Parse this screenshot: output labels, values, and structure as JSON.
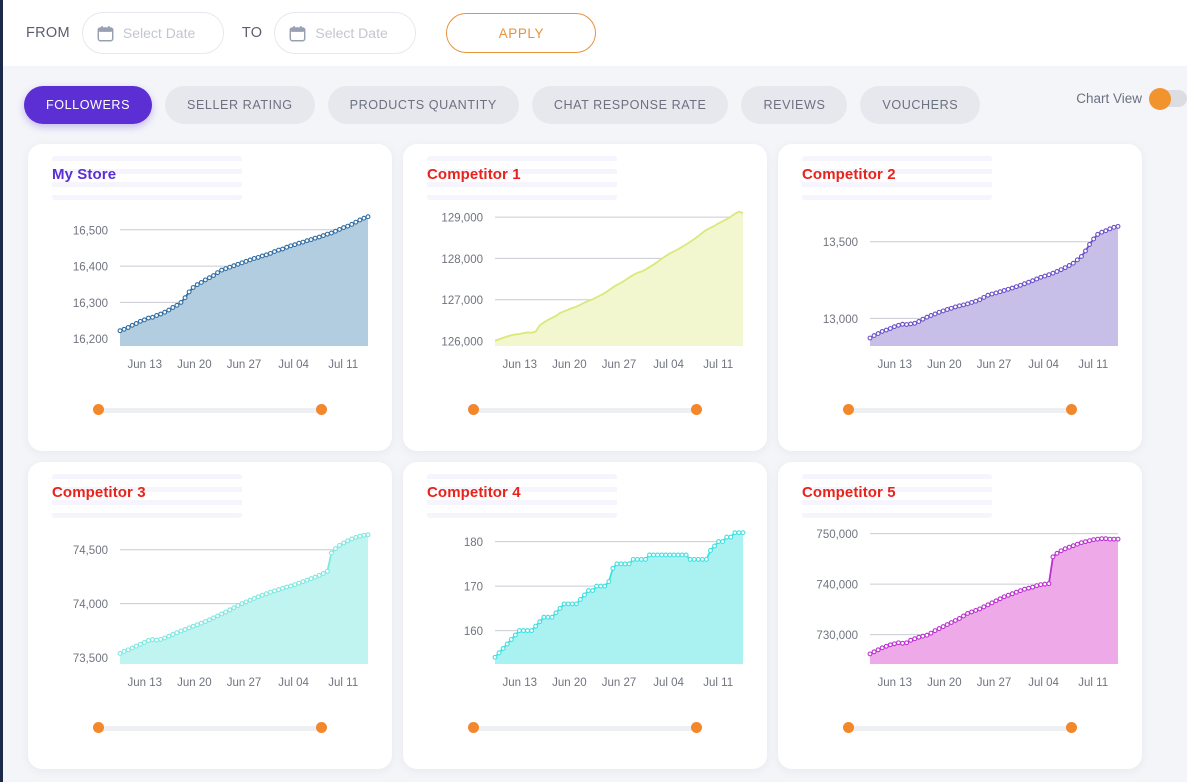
{
  "toolbar": {
    "from_label": "FROM",
    "to_label": "TO",
    "from_placeholder": "Select Date",
    "to_placeholder": "Select Date",
    "from_value": "",
    "to_value": "",
    "apply_label": "APPLY",
    "calendar_icon": "calendar-icon",
    "apply_color": "#e8923a"
  },
  "tabs": [
    {
      "label": "FOLLOWERS",
      "active": true
    },
    {
      "label": "SELLER RATING",
      "active": false
    },
    {
      "label": "PRODUCTS QUANTITY",
      "active": false
    },
    {
      "label": "CHAT RESPONSE RATE",
      "active": false
    },
    {
      "label": "REVIEWS",
      "active": false
    },
    {
      "label": "VOUCHERS",
      "active": false
    }
  ],
  "chart_view_toggle": {
    "label": "Chart View",
    "state": "on",
    "knob_color": "#f2942e",
    "track_color": "#dcdde3"
  },
  "colors": {
    "active_tab": "#5b2fd4",
    "competitor_title": "#e8231b",
    "mystore_title": "#5b2fd4",
    "slider_handle": "#f2872b",
    "page_background": "#f4f5f9"
  },
  "chart_data": [
    {
      "type": "area",
      "title": "My Store",
      "title_color": "#5b2fd4",
      "line_color": "#2e6da4",
      "fill_color": "#b3cde0",
      "marker": true,
      "xlabel": "",
      "ylabel": "",
      "ytick_labels": [
        "16,200",
        "16,300",
        "16,400",
        "16,500"
      ],
      "ylim": [
        16180,
        16560
      ],
      "xtick_labels": [
        "Jun 13",
        "Jun 20",
        "Jun 27",
        "Jul 04",
        "Jul 11"
      ],
      "grid": true,
      "legend": "none",
      "values": [
        16222,
        16226,
        16231,
        16237,
        16242,
        16248,
        16252,
        16257,
        16259,
        16264,
        16268,
        16273,
        16279,
        16286,
        16292,
        16300,
        16313,
        16329,
        16341,
        16349,
        16355,
        16362,
        16368,
        16374,
        16382,
        16389,
        16393,
        16397,
        16401,
        16405,
        16409,
        16413,
        16417,
        16421,
        16424,
        16428,
        16431,
        16435,
        16440,
        16444,
        16447,
        16452,
        16456,
        16459,
        16463,
        16466,
        16470,
        16473,
        16477,
        16480,
        16484,
        16488,
        16491,
        16496,
        16501,
        16506,
        16510,
        16515,
        16521,
        16527,
        16532,
        16536
      ]
    },
    {
      "type": "area",
      "title": "Competitor 1",
      "title_color": "#e8231b",
      "line_color": "#dbe87a",
      "fill_color": "#f2f7cf",
      "marker": false,
      "xlabel": "",
      "ylabel": "",
      "ytick_labels": [
        "126,000",
        "127,000",
        "128,000",
        "129,000"
      ],
      "ylim": [
        125880,
        129220
      ],
      "xtick_labels": [
        "Jun 13",
        "Jun 20",
        "Jun 27",
        "Jul 04",
        "Jul 11"
      ],
      "grid": true,
      "legend": "none",
      "values": [
        126010,
        126040,
        126080,
        126110,
        126140,
        126160,
        126170,
        126190,
        126210,
        126200,
        126230,
        126380,
        126450,
        126510,
        126560,
        126610,
        126680,
        126720,
        126760,
        126800,
        126830,
        126880,
        126930,
        126970,
        127010,
        127060,
        127110,
        127160,
        127230,
        127300,
        127360,
        127410,
        127470,
        127540,
        127600,
        127650,
        127680,
        127730,
        127790,
        127850,
        127920,
        127990,
        128060,
        128120,
        128170,
        128220,
        128280,
        128340,
        128400,
        128470,
        128540,
        128620,
        128690,
        128740,
        128790,
        128850,
        128900,
        128950,
        129010,
        129080,
        129130,
        129100
      ]
    },
    {
      "type": "area",
      "title": "Competitor 2",
      "title_color": "#e8231b",
      "line_color": "#6b4fc9",
      "fill_color": "#c8bfe8",
      "marker": true,
      "xlabel": "",
      "ylabel": "",
      "ytick_labels": [
        "13,000",
        "13,500"
      ],
      "ylim": [
        12820,
        13720
      ],
      "xtick_labels": [
        "Jun 13",
        "Jun 20",
        "Jun 27",
        "Jul 04",
        "Jul 11"
      ],
      "grid": true,
      "legend": "none",
      "values": [
        12872,
        12888,
        12901,
        12915,
        12924,
        12934,
        12946,
        12955,
        12962,
        12960,
        12964,
        12968,
        12980,
        12995,
        13008,
        13019,
        13029,
        13040,
        13049,
        13058,
        13066,
        13075,
        13082,
        13088,
        13095,
        13104,
        13112,
        13122,
        13137,
        13151,
        13159,
        13166,
        13174,
        13182,
        13190,
        13198,
        13207,
        13216,
        13226,
        13236,
        13246,
        13257,
        13268,
        13276,
        13285,
        13295,
        13306,
        13318,
        13331,
        13345,
        13360,
        13382,
        13404,
        13440,
        13482,
        13518,
        13548,
        13562,
        13572,
        13584,
        13594,
        13600
      ]
    },
    {
      "type": "area",
      "title": "Competitor 3",
      "title_color": "#e8231b",
      "line_color": "#7ce8e0",
      "fill_color": "#bff4f0",
      "marker": true,
      "xlabel": "",
      "ylabel": "",
      "ytick_labels": [
        "73,500",
        "74,000",
        "74,500"
      ],
      "ylim": [
        73440,
        74720
      ],
      "xtick_labels": [
        "Jun 13",
        "Jun 20",
        "Jun 27",
        "Jul 04",
        "Jul 11"
      ],
      "grid": true,
      "legend": "none",
      "values": [
        73538,
        73556,
        73572,
        73589,
        73606,
        73622,
        73640,
        73658,
        73666,
        73662,
        73668,
        73682,
        73698,
        73714,
        73730,
        73746,
        73760,
        73775,
        73790,
        73804,
        73818,
        73834,
        73850,
        73868,
        73886,
        73904,
        73922,
        73942,
        73962,
        73982,
        74000,
        74016,
        74032,
        74048,
        74064,
        74078,
        74092,
        74106,
        74118,
        74130,
        74142,
        74154,
        74164,
        74176,
        74190,
        74204,
        74218,
        74232,
        74246,
        74262,
        74280,
        74300,
        74470,
        74510,
        74540,
        74562,
        74582,
        74600,
        74614,
        74626,
        74634,
        74638
      ]
    },
    {
      "type": "area",
      "title": "Competitor 4",
      "title_color": "#e8231b",
      "line_color": "#3fe0e0",
      "fill_color": "#aaf2f2",
      "marker": true,
      "xlabel": "",
      "ylabel": "",
      "ytick_labels": [
        "160",
        "170",
        "180"
      ],
      "ylim": [
        152.5,
        183.5
      ],
      "xtick_labels": [
        "Jun 13",
        "Jun 20",
        "Jun 27",
        "Jul 04",
        "Jul 11"
      ],
      "grid": true,
      "legend": "none",
      "values": [
        154,
        155,
        156,
        157,
        158,
        159,
        160,
        160,
        160,
        160,
        161,
        162,
        163,
        163,
        163,
        164,
        165,
        166,
        166,
        166,
        166,
        167,
        168,
        169,
        169,
        170,
        170,
        170,
        171,
        174,
        175,
        175,
        175,
        175,
        176,
        176,
        176,
        176,
        177,
        177,
        177,
        177,
        177,
        177,
        177,
        177,
        177,
        177,
        176,
        176,
        176,
        176,
        176,
        178,
        179,
        180,
        180,
        181,
        181,
        182,
        182,
        182
      ]
    },
    {
      "type": "area",
      "title": "Competitor 5",
      "title_color": "#e8231b",
      "line_color": "#bb2fd0",
      "fill_color": "#eeaae8",
      "marker": true,
      "xlabel": "",
      "ylabel": "",
      "ytick_labels": [
        "730,000",
        "740,000",
        "750,000"
      ],
      "ylim": [
        724200,
        751500
      ],
      "xtick_labels": [
        "Jun 13",
        "Jun 20",
        "Jun 27",
        "Jul 04",
        "Jul 11"
      ],
      "grid": true,
      "legend": "none",
      "values": [
        726200,
        726600,
        727000,
        727400,
        727700,
        728000,
        728200,
        728400,
        728300,
        728400,
        728900,
        729200,
        729500,
        729700,
        729900,
        730300,
        730800,
        731200,
        731600,
        732000,
        732400,
        732800,
        733200,
        733700,
        734200,
        734500,
        734800,
        735100,
        735500,
        735900,
        736300,
        736700,
        737100,
        737500,
        737800,
        738100,
        738400,
        738700,
        739000,
        739200,
        739400,
        739700,
        739900,
        740000,
        740100,
        745400,
        746100,
        746600,
        747000,
        747300,
        747600,
        747900,
        748200,
        748400,
        748600,
        748800,
        748900,
        749000,
        749000,
        748900,
        748900,
        748900
      ]
    }
  ],
  "sliders": [
    {
      "left_handle": "range-start",
      "right_handle": "range-end"
    }
  ]
}
